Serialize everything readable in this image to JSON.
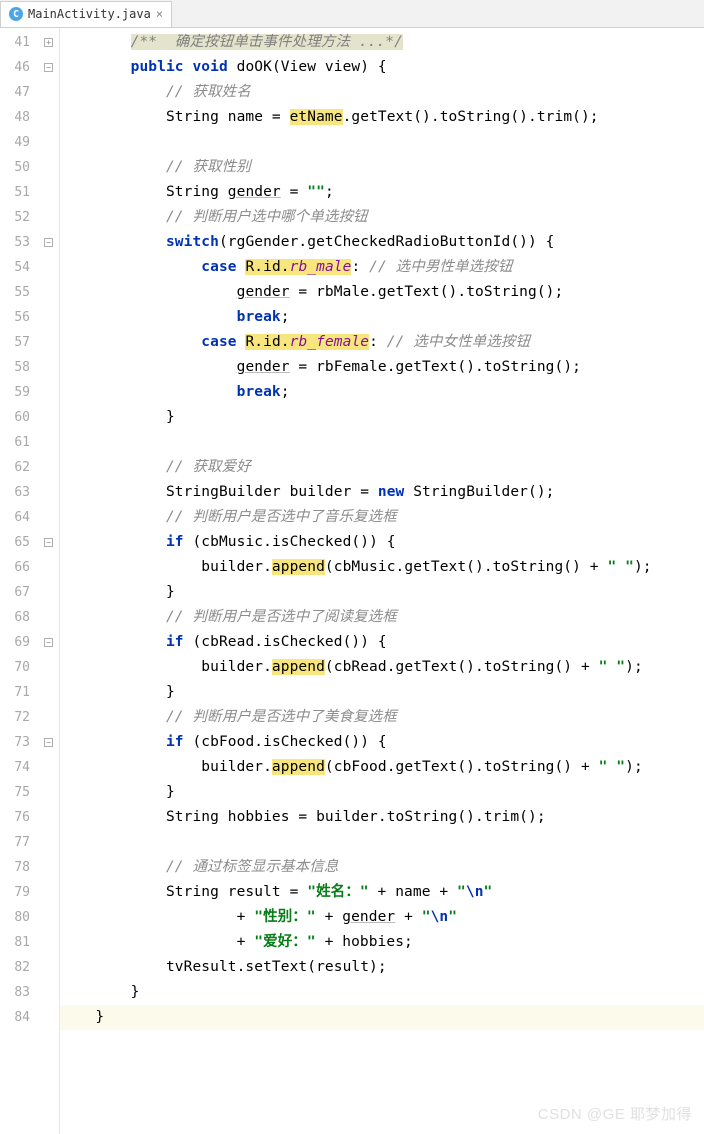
{
  "tab": {
    "icon_letter": "C",
    "filename": "MainActivity.java",
    "close": "×"
  },
  "line_numbers": [
    "41",
    "46",
    "47",
    "48",
    "49",
    "50",
    "51",
    "52",
    "53",
    "54",
    "55",
    "56",
    "57",
    "58",
    "59",
    "60",
    "61",
    "62",
    "63",
    "64",
    "65",
    "66",
    "67",
    "68",
    "69",
    "70",
    "71",
    "72",
    "73",
    "74",
    "75",
    "76",
    "77",
    "78",
    "79",
    "80",
    "81",
    "82",
    "83",
    "84"
  ],
  "fold": {
    "markers": {
      "0": "plus",
      "1": "minus",
      "8": "minus",
      "15": "close-s",
      "20": "minus",
      "22": "close-s",
      "24": "minus",
      "26": "close-s",
      "28": "minus",
      "30": "close-s",
      "38": "close",
      "39": "close"
    }
  },
  "code": {
    "l0": {
      "indent": "        ",
      "doc": "/**  确定按钮单击事件处理方法 ...*/"
    },
    "l1": {
      "indent": "        ",
      "kw1": "public",
      "sp1": " ",
      "kw2": "void",
      "after": " doOK(View view) {"
    },
    "l2": {
      "indent": "            ",
      "cmt": "// 获取姓名"
    },
    "l3": {
      "indent": "            ",
      "a": "String name = ",
      "b": "etName",
      "c": ".getText().toString().trim();"
    },
    "l4": {
      "indent": ""
    },
    "l5": {
      "indent": "            ",
      "cmt": "// 获取性别"
    },
    "l6": {
      "indent": "            ",
      "a": "String ",
      "b": "gender",
      "c": " = ",
      "d": "\"\"",
      "e": ";"
    },
    "l7": {
      "indent": "            ",
      "cmt": "// 判断用户选中哪个单选按钮"
    },
    "l8": {
      "indent": "            ",
      "kw": "switch",
      "a": "(rgGender.getCheckedRadioButtonId()) {"
    },
    "l9": {
      "indent": "                ",
      "kw": "case",
      "a": " ",
      "r1": "R",
      "r2": ".id.",
      "r3": "rb_male",
      "colon": ":",
      "sp": " ",
      "cmt": "// 选中男性单选按钮"
    },
    "l10": {
      "indent": "                    ",
      "a": "gender",
      "b": " = rbMale.getText().toString();"
    },
    "l11": {
      "indent": "                    ",
      "kw": "break",
      "a": ";"
    },
    "l12": {
      "indent": "                ",
      "kw": "case",
      "a": " ",
      "r1": "R",
      "r2": ".id.",
      "r3": "rb_female",
      "colon": ":",
      "sp": " ",
      "cmt": "// 选中女性单选按钮"
    },
    "l13": {
      "indent": "                    ",
      "a": "gender",
      "b": " = rbFemale.getText().toString();"
    },
    "l14": {
      "indent": "                    ",
      "kw": "break",
      "a": ";"
    },
    "l15": {
      "indent": "            ",
      "a": "}"
    },
    "l16": {
      "indent": ""
    },
    "l17": {
      "indent": "            ",
      "cmt": "// 获取爱好"
    },
    "l18": {
      "indent": "            ",
      "a": "StringBuilder builder = ",
      "kw": "new",
      "b": " StringBuilder();"
    },
    "l19": {
      "indent": "            ",
      "cmt": "// 判断用户是否选中了音乐复选框"
    },
    "l20": {
      "indent": "            ",
      "kw": "if",
      "a": " (cbMusic.isChecked()) {"
    },
    "l21": {
      "indent": "                ",
      "a": "builder.",
      "b": "append",
      "c": "(cbMusic.getText().toString() + ",
      "d": "\" \"",
      "e": ");"
    },
    "l22": {
      "indent": "            ",
      "a": "}"
    },
    "l23": {
      "indent": "            ",
      "cmt": "// 判断用户是否选中了阅读复选框"
    },
    "l24": {
      "indent": "            ",
      "kw": "if",
      "a": " (cbRead.isChecked()) {"
    },
    "l25": {
      "indent": "                ",
      "a": "builder.",
      "b": "append",
      "c": "(cbRead.getText().toString() + ",
      "d": "\" \"",
      "e": ");"
    },
    "l26": {
      "indent": "            ",
      "a": "}"
    },
    "l27": {
      "indent": "            ",
      "cmt": "// 判断用户是否选中了美食复选框"
    },
    "l28": {
      "indent": "            ",
      "kw": "if",
      "a": " (cbFood.isChecked()) {"
    },
    "l29": {
      "indent": "                ",
      "a": "builder.",
      "b": "append",
      "c": "(cbFood.getText().toString() + ",
      "d": "\" \"",
      "e": ");"
    },
    "l30": {
      "indent": "            ",
      "a": "}"
    },
    "l31": {
      "indent": "            ",
      "a": "String hobbies = builder.toString().trim();"
    },
    "l32": {
      "indent": ""
    },
    "l33": {
      "indent": "            ",
      "cmt": "// 通过标签显示基本信息"
    },
    "l34": {
      "indent": "            ",
      "a": "String result = ",
      "d": "\"姓名：\"",
      "b": " + name + ",
      "e": "\"",
      "esc": "\\n",
      "f": "\""
    },
    "l35": {
      "indent": "                    ",
      "a": "+ ",
      "d": "\"性别：\"",
      "b": " + ",
      "g": "gender",
      "c": " + ",
      "e": "\"",
      "esc": "\\n",
      "f": "\""
    },
    "l36": {
      "indent": "                    ",
      "a": "+ ",
      "d": "\"爱好：\"",
      "b": " + hobbies;"
    },
    "l37": {
      "indent": "            ",
      "a": "tvResult.setText(result);"
    },
    "l38": {
      "indent": "        ",
      "a": "}"
    },
    "l39": {
      "indent": "    ",
      "a": "}"
    }
  },
  "watermark": "CSDN @GE 耶梦加得"
}
